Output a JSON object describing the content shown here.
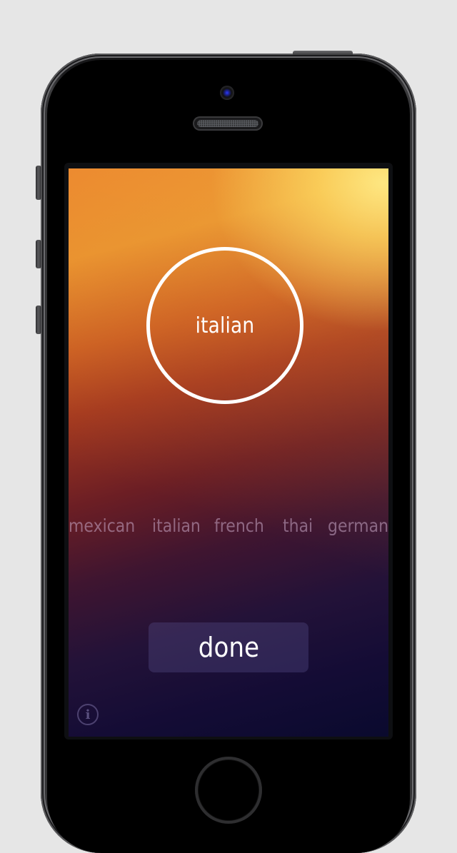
{
  "device": {
    "type": "phone",
    "finish": "space gray"
  },
  "app": {
    "selected_cuisine": "italian",
    "cuisine_options": [
      "mexican",
      "italian",
      "french",
      "thai",
      "german"
    ],
    "done_label": "done",
    "info_icon": "info-icon",
    "info_glyph": "i",
    "colors": {
      "gradient_top": "#fff28a",
      "gradient_orange": "#e6802a",
      "gradient_red": "#7a2024",
      "gradient_bottom": "#0a0a2e",
      "circle_stroke": "#ffffff",
      "label_text": "#ffffff",
      "cuisine_text_muted": "#8c6f8c",
      "done_button_bg": "#2f2850"
    }
  }
}
